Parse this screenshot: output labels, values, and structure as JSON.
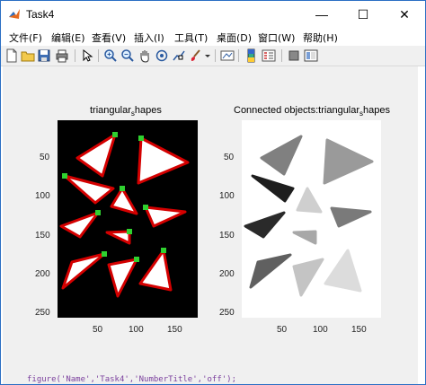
{
  "window": {
    "title": "Task4"
  },
  "window_controls": {
    "minimize": "—",
    "maximize": "☐",
    "close": "✕"
  },
  "menu": [
    "文件(F)",
    "编辑(E)",
    "查看(V)",
    "插入(I)",
    "工具(T)",
    "桌面(D)",
    "窗口(W)",
    "帮助(H)"
  ],
  "toolbar_icons": [
    "new-file-icon",
    "open-folder-icon",
    "save-icon",
    "print-icon",
    "pointer-icon",
    "zoom-in-icon",
    "zoom-out-icon",
    "pan-hand-icon",
    "rotate-3d-icon",
    "data-cursor-icon",
    "brush-icon",
    "brush-dropdown-icon",
    "link-plot-icon",
    "colorbar-icon",
    "legend-icon",
    "hide-plot-tools-icon",
    "show-plot-tools-icon"
  ],
  "axes_left": {
    "title": "triangular",
    "title_sub": "s",
    "title_tail": "hapes",
    "yticks": [
      "50",
      "100",
      "150",
      "200",
      "250"
    ],
    "xticks": [
      "50",
      "100",
      "150"
    ]
  },
  "axes_right": {
    "title": "Connected objects:triangular",
    "title_sub": "s",
    "title_tail": "hapes",
    "yticks": [
      "50",
      "100",
      "150",
      "200",
      "250"
    ],
    "xticks": [
      "50",
      "100",
      "150"
    ]
  },
  "bottom_code": "figure('Name','Task4','NumberTitle','off');",
  "colors": {
    "figure_bg": "#f0f0f0",
    "outline": "#d40000",
    "corner_marker": "#2fd12f"
  }
}
